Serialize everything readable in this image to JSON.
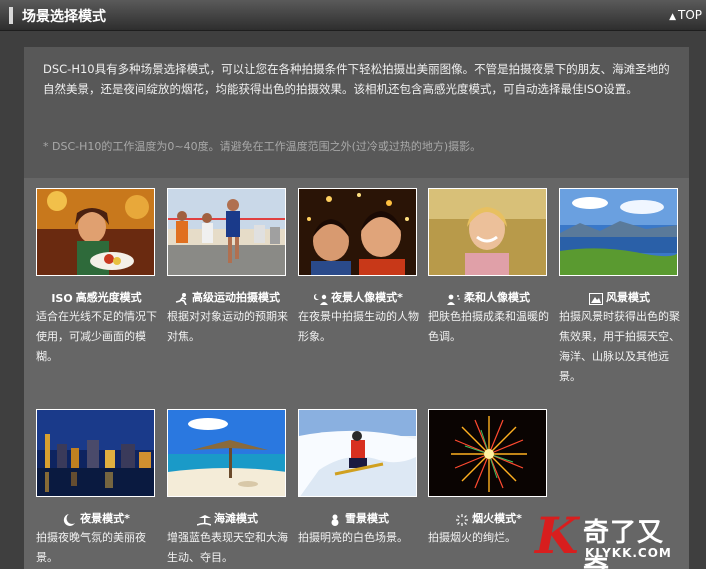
{
  "header": {
    "title": "场景选择模式",
    "top_link": "TOP"
  },
  "intro": {
    "text": "DSC-H10具有多种场景选择模式，可以让您在各种拍摄条件下轻松拍摄出美丽图像。不管是拍摄夜景下的朋友、海滩圣地的自然美景，还是夜间绽放的烟花，均能获得出色的拍摄效果。该相机还包含高感光度模式，可自动选择最佳ISO设置。",
    "note": "* DSC-H10的工作温度为0~40度。请避免在工作温度范围之外(过冷或过热的地方)摄影。"
  },
  "modes": [
    {
      "icon": "iso-icon",
      "icon_text": "ISO",
      "label": "高感光度模式",
      "desc": "适合在光线不足的情况下使用，可减少画面的模糊。"
    },
    {
      "icon": "sports-icon",
      "icon_text": "",
      "label": "高级运动拍摄模式",
      "desc": "根据对对象运动的预期来对焦。"
    },
    {
      "icon": "night-portrait-icon",
      "icon_text": "",
      "label": "夜景人像模式*",
      "desc": "在夜景中拍摄生动的人物形象。"
    },
    {
      "icon": "soft-portrait-icon",
      "icon_text": "",
      "label": "柔和人像模式",
      "desc": "把肤色拍摄成柔和温暖的色调。"
    },
    {
      "icon": "landscape-icon",
      "icon_text": "",
      "label": "风景模式",
      "desc": "拍摄风景时获得出色的聚焦效果，用于拍摄天空、海洋、山脉以及其他远景。"
    },
    {
      "icon": "night-scene-icon",
      "icon_text": "",
      "label": "夜景模式*",
      "desc": "拍摄夜晚气氛的美丽夜景。"
    },
    {
      "icon": "beach-icon",
      "icon_text": "",
      "label": "海滩模式",
      "desc": "增强蓝色表现天空和大海生动、夺目。"
    },
    {
      "icon": "snow-icon",
      "icon_text": "",
      "label": "雪景模式",
      "desc": "拍摄明亮的白色场景。"
    },
    {
      "icon": "fireworks-icon",
      "icon_text": "",
      "label": "烟火模式*",
      "desc": "拍摄烟火的绚烂。"
    }
  ],
  "logo": {
    "mark": "K",
    "name": "奇了又奇",
    "url": "KLYKK.COM"
  }
}
